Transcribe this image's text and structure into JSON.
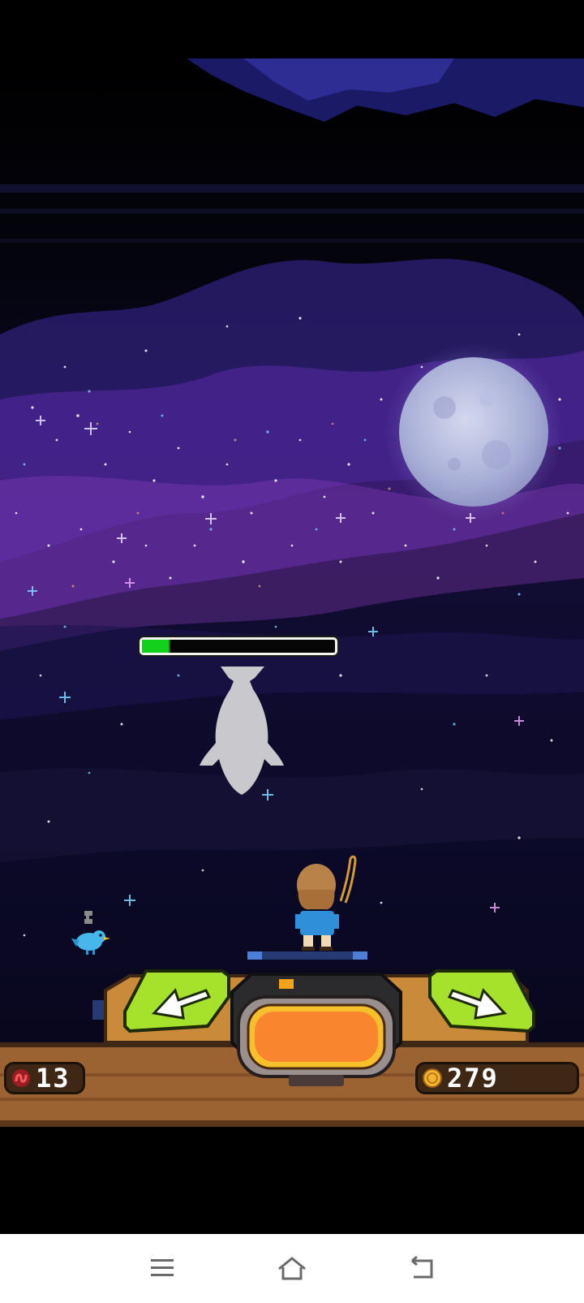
{
  "hud": {
    "bait_count": "13",
    "coin_count": "279"
  },
  "catch": {
    "progress": 0.14,
    "progress_color": "#13d11a"
  },
  "colors": {
    "sky_dark": "#050414",
    "nebula_purple": "#5b2aa8",
    "console_wood": "#c98a3a",
    "cast_button_orange": "#f9862f",
    "arrow_button_green": "#a6e22c",
    "nav_bg": "#ffffff"
  },
  "icons": {
    "bait": "worm-icon",
    "coin": "coin-icon",
    "left_button": "arrow-left-icon",
    "right_button": "arrow-right-icon",
    "nav_menu": "menu-icon",
    "nav_home": "home-icon",
    "nav_back": "back-icon"
  }
}
